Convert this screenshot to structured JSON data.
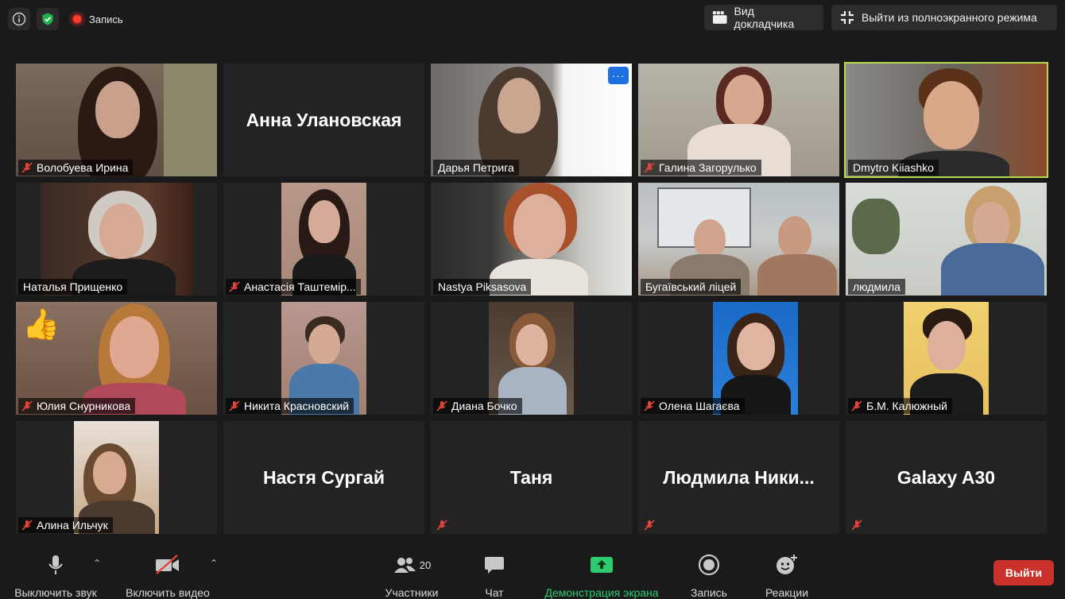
{
  "topbar": {
    "recording_label": "Запись",
    "speaker_view_label": "Вид докладчика",
    "exit_fullscreen_label": "Выйти из полноэкранного режима"
  },
  "tiles": [
    {
      "name": "Волобуева Ирина",
      "muted": true,
      "kind": "video"
    },
    {
      "name": "Анна Улановская",
      "muted": false,
      "kind": "name-only"
    },
    {
      "name": "Дарья Петрига",
      "muted": false,
      "kind": "video"
    },
    {
      "name": "Галина Загорулько",
      "muted": true,
      "kind": "video"
    },
    {
      "name": "Dmytro Kiiashko",
      "muted": false,
      "kind": "video",
      "active_speaker": true
    },
    {
      "name": "Наталья Прищенко",
      "muted": false,
      "kind": "video"
    },
    {
      "name": "Анастасія Таштемір...",
      "muted": true,
      "kind": "video"
    },
    {
      "name": "Nastya Piksasova",
      "muted": false,
      "kind": "video"
    },
    {
      "name": "Бугаївський ліцей",
      "muted": false,
      "kind": "video"
    },
    {
      "name": "людмила",
      "muted": false,
      "kind": "video"
    },
    {
      "name": "Юлия Снурникова",
      "muted": true,
      "kind": "video",
      "reaction": "👍"
    },
    {
      "name": "Никита Красновский",
      "muted": true,
      "kind": "video"
    },
    {
      "name": "Диана Бочко",
      "muted": true,
      "kind": "video"
    },
    {
      "name": "Олена Шагаєва",
      "muted": true,
      "kind": "video"
    },
    {
      "name": "Б.М. Калюжный",
      "muted": true,
      "kind": "video"
    },
    {
      "name": "Алина Ильчук",
      "muted": true,
      "kind": "video"
    },
    {
      "name": "Настя Сургай",
      "muted": true,
      "kind": "name-only"
    },
    {
      "name": "Таня",
      "muted": true,
      "kind": "name-only"
    },
    {
      "name": "Людмила  Ники...",
      "muted": true,
      "kind": "name-only"
    },
    {
      "name": "Galaxy A30",
      "muted": true,
      "kind": "name-only"
    }
  ],
  "toolbar": {
    "mute_label": "Выключить звук",
    "video_label": "Включить видео",
    "participants_label": "Участники",
    "participants_count": "20",
    "chat_label": "Чат",
    "share_label": "Демонстрация экрана",
    "record_label": "Запись",
    "reactions_label": "Реакции",
    "leave_label": "Выйти"
  },
  "colors": {
    "background": "#1a1a1a",
    "tile": "#232323",
    "active_speaker_border": "#b8d94a",
    "muted_icon": "#e0443a",
    "share_green": "#2ecc71",
    "leave_red": "#c8322b",
    "more_button_blue": "#1e6fe0"
  }
}
